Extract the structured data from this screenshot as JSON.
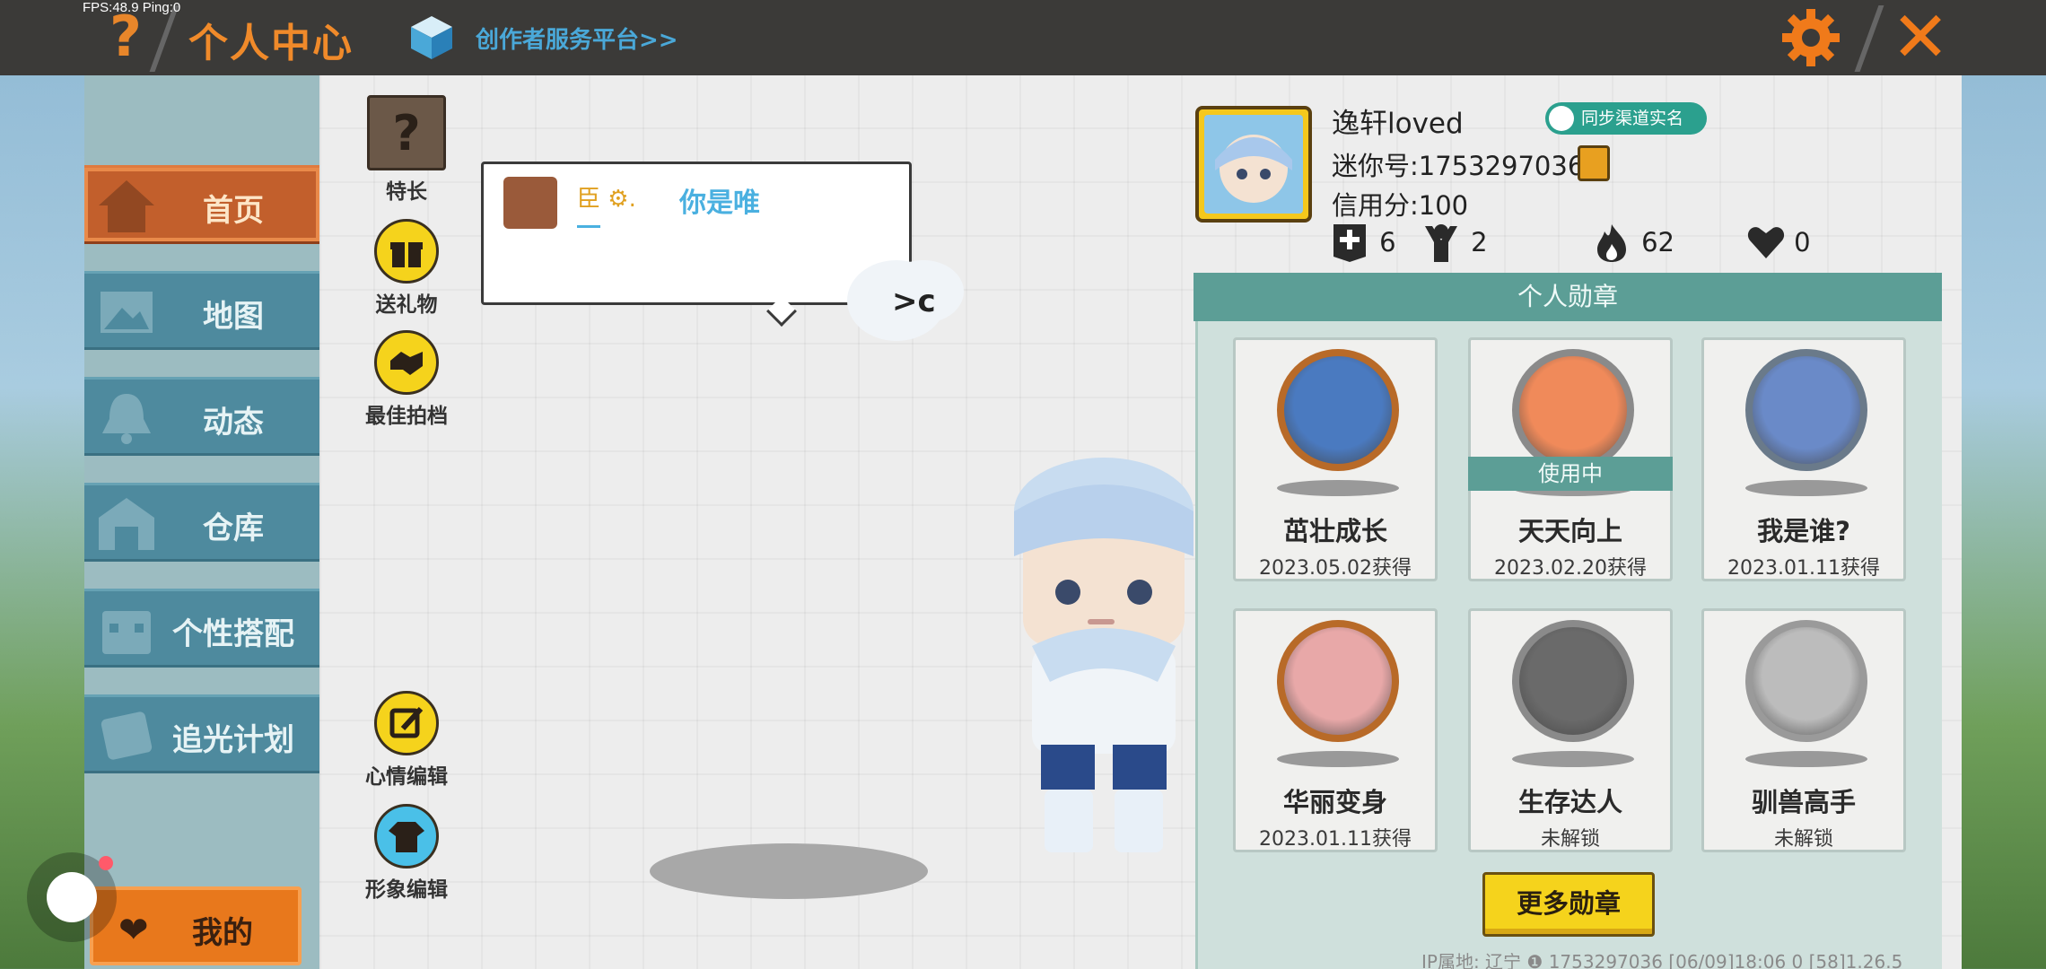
{
  "debug": {
    "fps_text": "FPS:48.9  Ping:0"
  },
  "header": {
    "help_label": "?",
    "title": "个人中心",
    "creator_link": "创作者服务平台>>",
    "close_label": "✕"
  },
  "sidebar": {
    "items": [
      {
        "label": "首页",
        "icon": "house-icon",
        "active": true
      },
      {
        "label": "地图",
        "icon": "map-icon",
        "active": false
      },
      {
        "label": "动态",
        "icon": "bell-icon",
        "active": false
      },
      {
        "label": "仓库",
        "icon": "warehouse-icon",
        "active": false
      },
      {
        "label": "个性搭配",
        "icon": "outfit-icon",
        "active": false
      },
      {
        "label": "追光计划",
        "icon": "light-plan-icon",
        "active": false
      }
    ],
    "mine_label": "我的"
  },
  "tools": {
    "specialty": {
      "label": "特长",
      "glyph": "?"
    },
    "send_gift": {
      "label": "送礼物"
    },
    "best_partner": {
      "label": "最佳拍档"
    },
    "mood_edit": {
      "label": "心情编辑"
    },
    "image_edit": {
      "label": "形象编辑"
    }
  },
  "bubble": {
    "badge_text": "臣 ⚙.",
    "text": "你是唯"
  },
  "cloud_text": ">c",
  "profile": {
    "username": "逸轩loved",
    "mini_id": "迷你号:1753297036",
    "credit": "信用分:100",
    "sync_badge": "同步渠道实名",
    "stats": [
      {
        "icon": "add-friend-icon",
        "value": "6"
      },
      {
        "icon": "fans-icon",
        "value": "2"
      },
      {
        "icon": "flame-icon",
        "value": "62"
      },
      {
        "icon": "heart-icon",
        "value": "0"
      }
    ]
  },
  "medals": {
    "title": "个人勋章",
    "items": [
      {
        "name": "茁壮成长",
        "date": "2023.05.02获得",
        "in_use": false,
        "unlocked": true,
        "ring": "#b86a28",
        "face": "#4a7ac0"
      },
      {
        "name": "天天向上",
        "date": "2023.02.20获得",
        "in_use": true,
        "in_use_label": "使用中",
        "unlocked": true,
        "ring": "#8a8a8a",
        "face": "#f08a5a"
      },
      {
        "name": "我是谁?",
        "date": "2023.01.11获得",
        "in_use": false,
        "unlocked": true,
        "ring": "#6a7a8a",
        "face": "#6a8ac8"
      },
      {
        "name": "华丽变身",
        "date": "2023.01.11获得",
        "in_use": false,
        "unlocked": true,
        "ring": "#b86a28",
        "face": "#e8a8a8"
      },
      {
        "name": "生存达人",
        "date": "未解锁",
        "in_use": false,
        "unlocked": false,
        "ring": "#8a8a8a",
        "face": "#6a6a6a"
      },
      {
        "name": "驯兽高手",
        "date": "未解锁",
        "in_use": false,
        "unlocked": false,
        "ring": "#9a9a9a",
        "face": "#bcbcbc"
      }
    ],
    "more_label": "更多勋章"
  },
  "footer": {
    "text": "IP属地: 辽宁 ❶     1753297036     [06/09]18:06 0   [58]1.26.5"
  }
}
